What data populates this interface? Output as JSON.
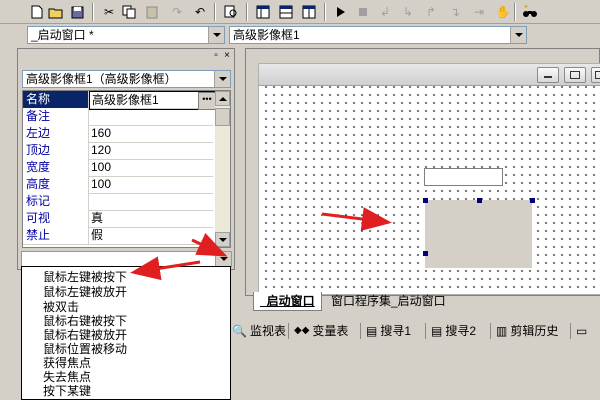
{
  "toolbar": {
    "icons": [
      "new-file",
      "open",
      "save",
      "cut",
      "copy",
      "paste",
      "redo",
      "undo",
      "find",
      "layout-1",
      "layout-2",
      "layout-3",
      "run",
      "stop",
      "step-into",
      "step-over",
      "step-out",
      "run-to-cursor",
      "pause",
      "debug-binoculars"
    ]
  },
  "window_combo": {
    "value": "_启动窗口 *"
  },
  "component_combo": {
    "value": "高级影像框1"
  },
  "left_panel": {
    "object_combo": {
      "value": "高级影像框1（高级影像框）"
    },
    "properties": [
      {
        "name": "名称",
        "value": "高级影像框1"
      },
      {
        "name": "备注",
        "value": ""
      },
      {
        "name": "左边",
        "value": "160"
      },
      {
        "name": "顶边",
        "value": "120"
      },
      {
        "name": "宽度",
        "value": "100"
      },
      {
        "name": "高度",
        "value": "100"
      },
      {
        "name": "标记",
        "value": ""
      },
      {
        "name": "可视",
        "value": "真"
      },
      {
        "name": "禁止",
        "value": "假"
      }
    ],
    "event_combo": {
      "value": ""
    }
  },
  "event_list": {
    "items": [
      "鼠标左键被按下",
      "鼠标左键被放开",
      "被双击",
      "鼠标右键被按下",
      "鼠标右键被放开",
      "鼠标位置被移动",
      "获得焦点",
      "失去焦点",
      "按下某键"
    ]
  },
  "tabs": [
    {
      "label": "_启动窗口"
    },
    {
      "label": "窗口程序集_启动窗口"
    }
  ],
  "bottom_bar": {
    "items": [
      {
        "label": "监视表"
      },
      {
        "label": "变量表"
      },
      {
        "label": "搜寻1"
      },
      {
        "label": "搜寻2"
      },
      {
        "label": "剪辑历史"
      }
    ]
  },
  "colors": {
    "selection": "#0a246a",
    "property_name": "#0000a0",
    "annotation_arrow": "#e02020",
    "handle": "#000080"
  }
}
